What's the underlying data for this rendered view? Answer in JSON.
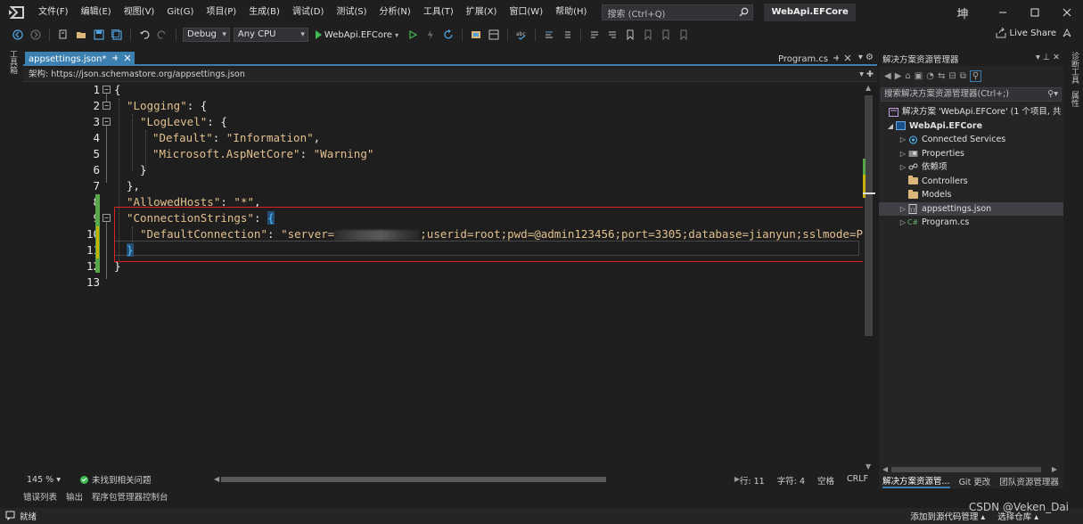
{
  "menu": {
    "items": [
      "文件(F)",
      "编辑(E)",
      "视图(V)",
      "Git(G)",
      "项目(P)",
      "生成(B)",
      "调试(D)",
      "测试(S)",
      "分析(N)",
      "工具(T)",
      "扩展(X)",
      "窗口(W)",
      "帮助(H)"
    ],
    "search_placeholder": "搜索 (Ctrl+Q)",
    "solution_name": "WebApi.EFCore",
    "user_glyph": "坤"
  },
  "toolbar": {
    "config": "Debug",
    "platform": "Any CPU",
    "run_target": "WebApi.EFCore",
    "live_share": "Live Share"
  },
  "left_strip": {
    "toolbox_label": "工具箱"
  },
  "editor": {
    "active_tab": "appsettings.json*",
    "inactive_tab": "Program.cs",
    "schema": "架构: https://json.schemastore.org/appsettings.json",
    "line_numbers": [
      "1",
      "2",
      "3",
      "4",
      "5",
      "6",
      "7",
      "8",
      "9",
      "10",
      "11",
      "12",
      "13"
    ],
    "code": {
      "l1": "{",
      "l2_key": "\"Logging\"",
      "l2_rest": ": {",
      "l3_key": "\"LogLevel\"",
      "l3_rest": ": {",
      "l4_key": "\"Default\"",
      "l4_sep": ": ",
      "l4_val": "\"Information\"",
      "l4_end": ",",
      "l5_key": "\"Microsoft.AspNetCore\"",
      "l5_sep": ": ",
      "l5_val": "\"Warning\"",
      "l6": "}",
      "l7": "},",
      "l8_key": "\"AllowedHosts\"",
      "l8_sep": ": ",
      "l8_val": "\"*\"",
      "l8_end": ",",
      "l9_key": "\"ConnectionStrings\"",
      "l9_sep": ": ",
      "l9_brace": "{",
      "l10_key": "\"DefaultConnection\"",
      "l10_sep": ": ",
      "l10_val_start": "\"server=",
      "l10_val_rest": ";userid=root;pwd=@admin123456;port=3305;database=jianyun;sslmode=Prefe",
      "l11": "}",
      "l12": "}"
    }
  },
  "editor_status": {
    "zoom": "145 %",
    "issues": "未找到相关问题",
    "line": "行: 11",
    "char": "字符: 4",
    "space": "空格",
    "eol": "CRLF"
  },
  "bottom_tabs": [
    "错误列表",
    "输出",
    "程序包管理器控制台"
  ],
  "statusbar": {
    "ready": "就绪",
    "add_source": "添加到源代码管理 ▴",
    "select_repo": "选择仓库 ▴"
  },
  "watermark": "CSDN @Veken_Dai",
  "solution_explorer": {
    "title": "解决方案资源管理器",
    "search_placeholder": "搜索解决方案资源管理器(Ctrl+;)",
    "solution_label": "解决方案 'WebApi.EFCore' (1 个项目, 共",
    "project": "WebApi.EFCore",
    "items": {
      "connected": "Connected Services",
      "properties": "Properties",
      "deps": "依赖项",
      "controllers": "Controllers",
      "models": "Models",
      "appsettings": "appsettings.json",
      "program": "Program.cs"
    },
    "bottom_tabs": [
      "解决方案资源管...",
      "Git 更改",
      "团队资源管理器"
    ]
  },
  "right_strip": {
    "labels": [
      "诊断工具",
      "属性"
    ]
  },
  "colors": {
    "accent": "#3c7fb1",
    "json_string": "#e2c08d",
    "highlight_box": "#e02020",
    "added_line": "#57a64a",
    "modified_line": "#c9b100"
  }
}
